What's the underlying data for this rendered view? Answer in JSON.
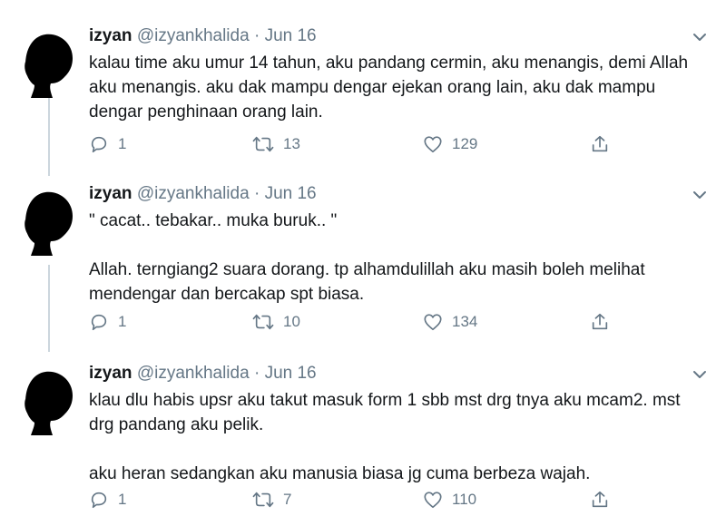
{
  "tweets": [
    {
      "name": "izyan",
      "handle": "@izyankhalida",
      "separator": "·",
      "date": "Jun 16",
      "paragraphs": [
        "kalau time aku umur 14 tahun,  aku pandang cermin, aku menangis,  demi Allah aku menangis. aku dak mampu dengar ejekan orang lain,  aku dak mampu dengar penghinaan orang lain."
      ],
      "replies": "1",
      "retweets": "13",
      "likes": "129"
    },
    {
      "name": "izyan",
      "handle": "@izyankhalida",
      "separator": "·",
      "date": "Jun 16",
      "paragraphs": [
        "\" cacat.. tebakar.. muka buruk..  \"",
        "Allah.  terngiang2 suara dorang. tp alhamdulillah aku masih boleh melihat mendengar dan bercakap spt biasa."
      ],
      "replies": "1",
      "retweets": "10",
      "likes": "134"
    },
    {
      "name": "izyan",
      "handle": "@izyankhalida",
      "separator": "·",
      "date": "Jun 16",
      "paragraphs": [
        "klau dlu habis upsr aku takut masuk form 1 sbb mst drg tnya aku mcam2.  mst drg pandang aku pelik.",
        "aku heran sedangkan aku manusia biasa jg cuma berbeza wajah."
      ],
      "replies": "1",
      "retweets": "7",
      "likes": "110"
    }
  ],
  "icons": {
    "avatar": "silhouette-avatar",
    "menu": "chevron-down-icon",
    "reply": "reply-icon",
    "retweet": "retweet-icon",
    "like": "heart-icon",
    "share": "share-icon"
  },
  "colors": {
    "text": "#14171a",
    "secondary": "#657786",
    "thread_line": "#ccd6dd"
  }
}
